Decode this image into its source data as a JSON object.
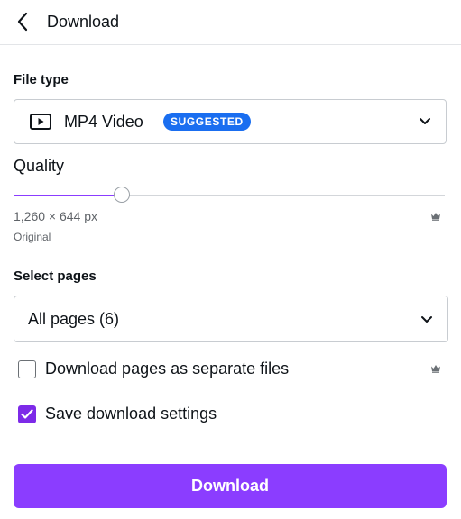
{
  "header": {
    "title": "Download",
    "back_icon": "chevron-left-icon"
  },
  "file_type": {
    "label": "File type",
    "value": "MP4 Video",
    "badge": "SUGGESTED",
    "icon": "video-play-icon"
  },
  "quality": {
    "label": "Quality",
    "level": 0.25,
    "dimensions": "1,260 × 644 px",
    "sublabel": "Original",
    "premium_icon": "crown-icon"
  },
  "select_pages": {
    "label": "Select pages",
    "value": "All pages (6)"
  },
  "options": {
    "separate_files": {
      "label": "Download pages as separate files",
      "checked": false,
      "premium_icon": "crown-icon"
    },
    "save_settings": {
      "label": "Save download settings",
      "checked": true
    }
  },
  "download_button": {
    "label": "Download"
  },
  "colors": {
    "accent": "#8b3dff",
    "badge": "#1a6ef0",
    "checkbox": "#7d2ae8"
  }
}
